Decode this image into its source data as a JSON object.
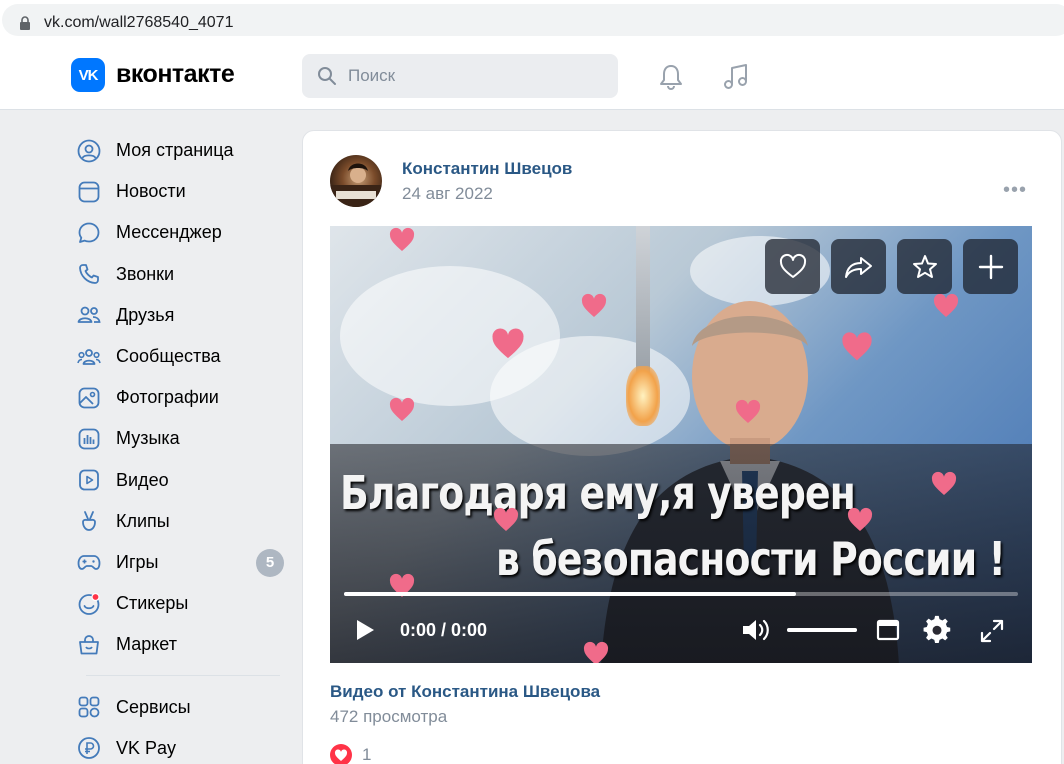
{
  "browser": {
    "url": "vk.com/wall2768540_4071"
  },
  "header": {
    "logo_mark": "VK",
    "logo_text": "вконтакте",
    "search_placeholder": "Поиск",
    "brand_color": "#0077ff"
  },
  "sidebar": {
    "items": [
      {
        "label": "Моя страница",
        "icon": "user-circle-icon"
      },
      {
        "label": "Новости",
        "icon": "news-icon"
      },
      {
        "label": "Мессенджер",
        "icon": "message-icon"
      },
      {
        "label": "Звонки",
        "icon": "phone-icon"
      },
      {
        "label": "Друзья",
        "icon": "friends-icon"
      },
      {
        "label": "Сообщества",
        "icon": "communities-icon"
      },
      {
        "label": "Фотографии",
        "icon": "photo-icon"
      },
      {
        "label": "Музыка",
        "icon": "music-icon"
      },
      {
        "label": "Видео",
        "icon": "video-icon"
      },
      {
        "label": "Клипы",
        "icon": "clips-icon"
      },
      {
        "label": "Игры",
        "icon": "games-icon",
        "badge": "5"
      },
      {
        "label": "Стикеры",
        "icon": "stickers-icon"
      },
      {
        "label": "Маркет",
        "icon": "market-icon"
      }
    ],
    "extra_items": [
      {
        "label": "Сервисы",
        "icon": "services-icon"
      },
      {
        "label": "VK Pay",
        "icon": "vkpay-icon"
      }
    ]
  },
  "post": {
    "author": "Константин Швецов",
    "date": "24 авг 2022",
    "more": "•••",
    "video": {
      "caption_line1": "Благодаря ему,я уверен",
      "caption_line2": "в безопасности России !",
      "time": "0:00 / 0:00",
      "progress": 0.67,
      "volume": 1.0,
      "title": "Видео от Константина Швецова",
      "views": "472 просмотра"
    },
    "likes": "1"
  }
}
